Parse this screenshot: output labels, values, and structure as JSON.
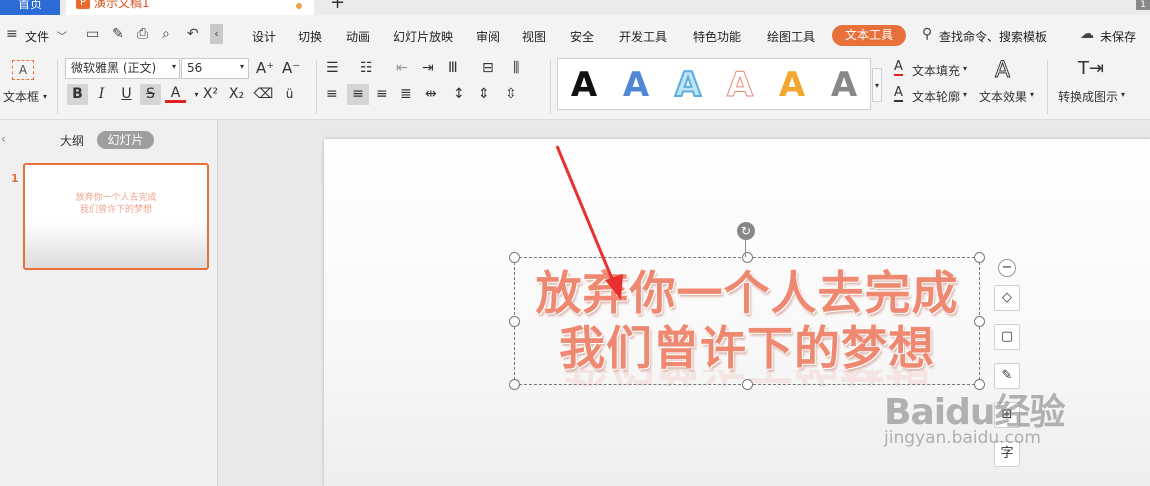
{
  "tabs": {
    "home": "首页",
    "doc_logo": "P",
    "doc_name": "演示文稿1",
    "add": "+",
    "corner": "1"
  },
  "menu": {
    "file": "文件",
    "items": [
      "设计",
      "切换",
      "动画",
      "幻灯片放映",
      "审阅",
      "视图",
      "安全",
      "开发工具",
      "特色功能",
      "绘图工具",
      "文本工具"
    ],
    "search": "查找命令、搜索模板",
    "unsaved": "未保存"
  },
  "ribbon": {
    "textbox_label": "文本框",
    "font_name": "微软雅黑 (正文)",
    "font_size": "56",
    "style_letter": "A",
    "fill_label": "文本填充",
    "outline_label": "文本轮廓",
    "effect_label": "文本效果",
    "convert_label": "转换成图示"
  },
  "pane": {
    "outline_tab": "大纲",
    "slides_tab": "幻灯片",
    "slide_number": "1",
    "thumb_line1": "放弃你一个人去完成",
    "thumb_line2": "我们曾许下的梦想"
  },
  "slide": {
    "line1": "放弃你一个人去完成",
    "line2": "我们曾许下的梦想"
  },
  "watermark": {
    "brand": "Baidu经验",
    "url": "jingyan.baidu.com"
  },
  "colors": {
    "accent": "#e8703a",
    "text_fill": "#ee8870",
    "home_tab": "#2b6bd6"
  }
}
